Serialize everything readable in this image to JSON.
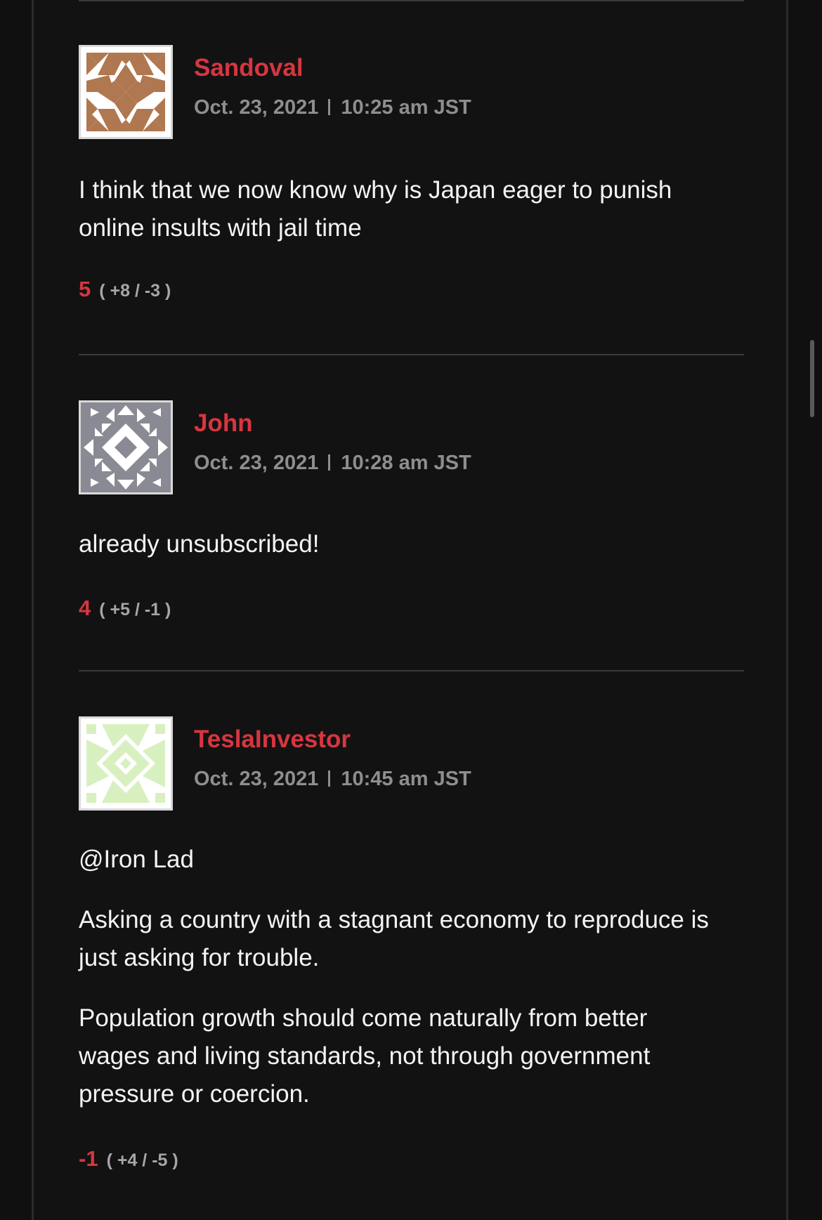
{
  "comments": [
    {
      "author": "Sandoval",
      "date": "Oct. 23, 2021",
      "time": "10:25 am JST",
      "paragraphs": [
        "I think that we now know why is Japan eager to punish online insults with jail time"
      ],
      "score": "5",
      "detail": "( +8 / -3 )",
      "avatar_color": "#b07850"
    },
    {
      "author": "John",
      "date": "Oct. 23, 2021",
      "time": "10:28 am JST",
      "paragraphs": [
        "already unsubscribed!"
      ],
      "score": "4",
      "detail": "( +5 / -1 )",
      "avatar_color": "#8a8a94"
    },
    {
      "author": "TeslaInvestor",
      "date": "Oct. 23, 2021",
      "time": "10:45 am JST",
      "paragraphs": [
        "@Iron Lad",
        "Asking a country with a stagnant economy to reproduce is just asking for trouble.",
        "Population growth should come naturally from better wages and living standards, not through government pressure or coercion."
      ],
      "score": "-1",
      "detail": "( +4 / -5 )",
      "avatar_color": "#d8f0c0"
    }
  ],
  "colors": {
    "background": "#121213",
    "accent": "#d7363f",
    "meta": "#8e8e90",
    "text": "#f4f4f4",
    "divider": "#3a3a3d"
  }
}
